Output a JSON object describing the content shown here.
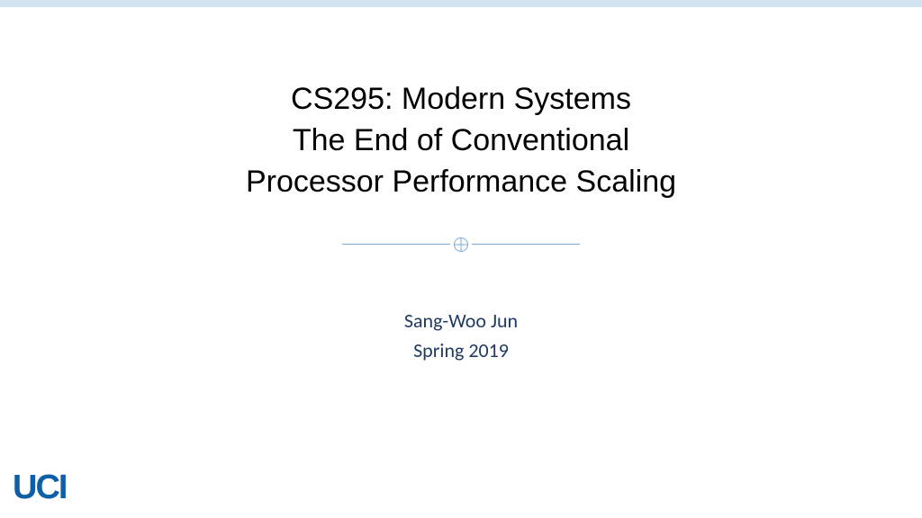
{
  "title": {
    "line1": "CS295: Modern Systems",
    "line2": "The End of Conventional",
    "line3": "Processor Performance Scaling"
  },
  "author": "Sang-Woo Jun",
  "semester": "Spring 2019",
  "logo_text": "UCI",
  "colors": {
    "top_bar": "#d4e3f0",
    "divider": "#7ba8d4",
    "author_text": "#1f3a63",
    "logo": "#0f5fa8"
  }
}
